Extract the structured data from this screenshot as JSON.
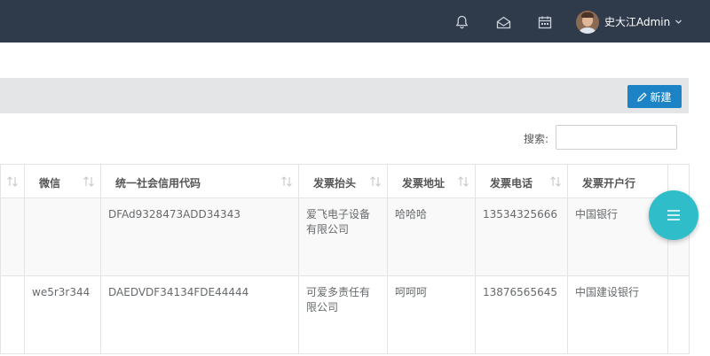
{
  "header": {
    "user_name": "史大江Admin",
    "icons": [
      "bell-icon",
      "envelope-icon",
      "calendar-icon",
      "chevron-down-icon"
    ]
  },
  "toolbar": {
    "new_label": "新建"
  },
  "search": {
    "label": "搜索:"
  },
  "table": {
    "columns": [
      "微信",
      "统一社会信用代码",
      "发票抬头",
      "发票地址",
      "发票电话",
      "发票开户行"
    ],
    "rows": [
      {
        "wechat": "",
        "credit_code": "DFAd9328473ADD34343",
        "invoice_title": "爱飞电子设备有限公司",
        "invoice_address": "哈哈哈",
        "invoice_phone": "13534325666",
        "invoice_bank": "中国银行"
      },
      {
        "wechat": "we5r3r344",
        "credit_code": "DAEDVDF34134FDE44444",
        "invoice_title": "可爱多责任有限公司",
        "invoice_address": "呵呵呵",
        "invoice_phone": "13876565645",
        "invoice_bank": "中国建设银行"
      }
    ]
  },
  "colors": {
    "topbar": "#2f3a4a",
    "primary_button": "#1c84c6",
    "fab": "#2fbec9"
  }
}
